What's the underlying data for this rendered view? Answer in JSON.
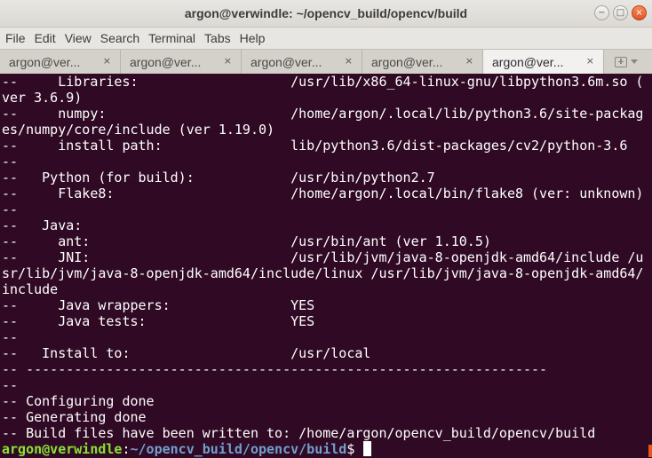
{
  "window": {
    "title": "argon@verwindle: ~/opencv_build/opencv/build",
    "buttons": {
      "minimize": "−",
      "maximize": "□",
      "close": "×"
    }
  },
  "menu": [
    "File",
    "Edit",
    "View",
    "Search",
    "Terminal",
    "Tabs",
    "Help"
  ],
  "tabs": [
    {
      "label": "argon@ver...",
      "close": "×",
      "active": false
    },
    {
      "label": "argon@ver...",
      "close": "×",
      "active": false
    },
    {
      "label": "argon@ver...",
      "close": "×",
      "active": false
    },
    {
      "label": "argon@ver...",
      "close": "×",
      "active": false
    },
    {
      "label": "argon@ver...",
      "close": "×",
      "active": true
    }
  ],
  "terminal": {
    "lines": [
      "--     Libraries:                   /usr/lib/x86_64-linux-gnu/libpython3.6m.so (",
      "ver 3.6.9)",
      "--     numpy:                       /home/argon/.local/lib/python3.6/site-packag",
      "es/numpy/core/include (ver 1.19.0)",
      "--     install path:                lib/python3.6/dist-packages/cv2/python-3.6",
      "--",
      "--   Python (for build):            /usr/bin/python2.7",
      "--     Flake8:                      /home/argon/.local/bin/flake8 (ver: unknown)",
      "--",
      "--   Java:",
      "--     ant:                         /usr/bin/ant (ver 1.10.5)",
      "--     JNI:                         /usr/lib/jvm/java-8-openjdk-amd64/include /u",
      "sr/lib/jvm/java-8-openjdk-amd64/include/linux /usr/lib/jvm/java-8-openjdk-amd64/",
      "include",
      "--     Java wrappers:               YES",
      "--     Java tests:                  YES",
      "--",
      "--   Install to:                    /usr/local",
      "-- -----------------------------------------------------------------",
      "--",
      "-- Configuring done",
      "-- Generating done",
      "-- Build files have been written to: /home/argon/opencv_build/opencv/build"
    ],
    "prompt": {
      "user_host": "argon@verwindle",
      "separator": ":",
      "path": "~/opencv_build/opencv/build",
      "symbol": "$ "
    }
  }
}
